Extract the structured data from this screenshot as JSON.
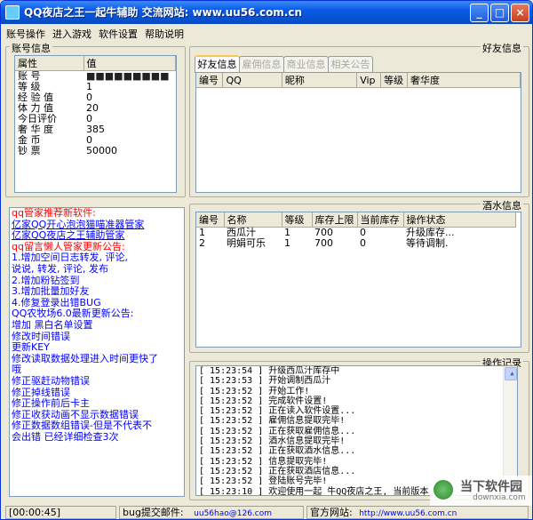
{
  "window": {
    "title": "QQ夜店之王一起牛辅助  交流网站: www.uu56.com.cn"
  },
  "menu": [
    "账号操作",
    "进入游戏",
    "软件设置",
    "帮助说明"
  ],
  "account": {
    "label": "账号信息",
    "columns": [
      "属性",
      "值"
    ],
    "rows": [
      {
        "k": "账      号",
        "v": "■■■■■■■■■"
      },
      {
        "k": "等      级",
        "v": "1"
      },
      {
        "k": "经 验 值",
        "v": "0"
      },
      {
        "k": "体 力 值",
        "v": "20"
      },
      {
        "k": "今日评价",
        "v": "0"
      },
      {
        "k": "奢 华 度",
        "v": "385"
      },
      {
        "k": "金      币",
        "v": "0"
      },
      {
        "k": "钞      票",
        "v": "50000"
      }
    ]
  },
  "friends": {
    "label": "好友信息",
    "tabs": [
      "好友信息",
      "雇佣信息",
      "商业信息",
      "相关公告"
    ],
    "columns": [
      "编号",
      "QQ",
      "昵称",
      "Vip",
      "等级",
      "奢华度"
    ]
  },
  "ads": [
    {
      "text": "qq管家推荐新软件:",
      "color": "#ff0000"
    },
    {
      "text": "亿家QQ开心泡泡猫喵准器管家",
      "color": "#0000ff",
      "link": true
    },
    {
      "text": "亿家QQ夜店之王辅助管家",
      "color": "#0000ff",
      "link": true
    },
    {
      "text": "qq留言懒人管家更新公告:",
      "color": "#ff0000"
    },
    {
      "text": "1.增加空间日志转发, 评论,",
      "color": "#0000ff"
    },
    {
      "text": "说说, 转发, 评论, 发布",
      "color": "#0000ff"
    },
    {
      "text": "2.增加粉钻签到",
      "color": "#0000ff"
    },
    {
      "text": "3.增加批量加好友",
      "color": "#0000ff"
    },
    {
      "text": "4.修复登录出错BUG",
      "color": "#0000ff"
    },
    {
      "text": "QQ农牧场6.0最新更新公告:",
      "color": "#0000ff"
    },
    {
      "text": "增加  黑白名单设置",
      "color": "#0000ff"
    },
    {
      "text": "修改时间错误",
      "color": "#0000ff"
    },
    {
      "text": "更新KEY",
      "color": "#0000ff"
    },
    {
      "text": "修改读取数据处理进入时间更快了",
      "color": "#0000ff"
    },
    {
      "text": "哦",
      "color": "#0000ff"
    },
    {
      "text": "修正驱赶动物错误",
      "color": "#0000ff"
    },
    {
      "text": "修正掉线错误",
      "color": "#0000ff"
    },
    {
      "text": "修正操作前后卡主",
      "color": "#0000ff"
    },
    {
      "text": "修正收获动画不显示数据错误",
      "color": "#0000ff"
    },
    {
      "text": "修正数据数组错误-但是不代表不",
      "color": "#0000ff"
    },
    {
      "text": "会出错  已经详细检查3次",
      "color": "#0000ff"
    }
  ],
  "wine": {
    "label": "酒水信息",
    "columns": [
      "编号",
      "名称",
      "等级",
      "库存上限",
      "当前库存",
      "操作状态"
    ],
    "rows": [
      [
        "1",
        "西瓜汁",
        "1",
        "700",
        "0",
        "升级库存..."
      ],
      [
        "2",
        "明娟可乐",
        "1",
        "700",
        "0",
        "等待调制."
      ]
    ]
  },
  "log": {
    "label": "操作记录",
    "lines": [
      "[ 15:23:54 ] 升级西瓜汁库存中",
      "[ 15:23:53 ] 开始调制西瓜汁",
      "[ 15:23:52 ] 开始工作!",
      "[ 15:23:52 ] 完成软件设置!",
      "[ 15:23:52 ] 正在读入软件设置...",
      "[ 15:23:52 ] 雇佣信息提取完毕!",
      "[ 15:23:52 ] 正在获取雇佣信息...",
      "[ 15:23:52 ] 酒水信息提取完毕!",
      "[ 15:23:52 ] 正在获取酒水信息...",
      "[ 15:23:52 ] 信息提取完毕!",
      "[ 15:23:52 ] 正在获取酒店信息...",
      "[ 15:23:52 ] 登陆账号完毕!",
      "[ 15:23:10 ] 欢迎使用一起 牛QQ夜店之王, 当前版本 V1.0"
    ]
  },
  "status": {
    "timer": "[00:00:45]",
    "bug_label": "bug提交邮件:",
    "email": "uu56hao@126.com",
    "site_label": "官方网站:",
    "site": "http://www.uu56.com.cn"
  },
  "watermark": {
    "name": "当下软件园",
    "url": "downxia.com"
  }
}
